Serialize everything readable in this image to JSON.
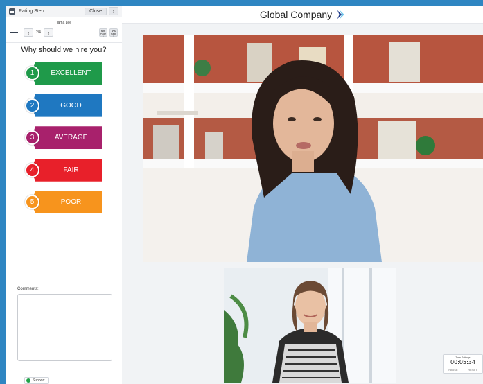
{
  "panel": {
    "title": "Rating Step",
    "close_label": "Close",
    "next_label": "›",
    "candidate_name": "Tama Lee",
    "prev_arrow": "‹",
    "next_arrow": "›",
    "page_count": "2/4",
    "stats": [
      {
        "value": "0%",
        "label": "Page 1"
      },
      {
        "value": "0%",
        "label": "Page 1"
      }
    ],
    "question": "Why should we hire you?",
    "options": [
      {
        "number": "1",
        "label": "EXCELLENT",
        "color": "#1f9a4a"
      },
      {
        "number": "2",
        "label": "GOOD",
        "color": "#1f78c1"
      },
      {
        "number": "3",
        "label": "AVERAGE",
        "color": "#a8216c"
      },
      {
        "number": "4",
        "label": "FAIR",
        "color": "#e8202a"
      },
      {
        "number": "5",
        "label": "POOR",
        "color": "#f7941d"
      }
    ],
    "comments_label": "Comments:",
    "support_label": "Support"
  },
  "main": {
    "company_name": "Global Company",
    "logo_colors": [
      "#1e3a8a",
      "#2f86c2",
      "#6cc3ea"
    ]
  },
  "timer": {
    "caption": "Time Settings",
    "value": "00:05:34",
    "pause_label": "PAUSE",
    "reset_label": "RESET"
  },
  "colors": {
    "background": "#2f86c2",
    "panel": "#ffffff",
    "main": "#f1f3f5"
  }
}
